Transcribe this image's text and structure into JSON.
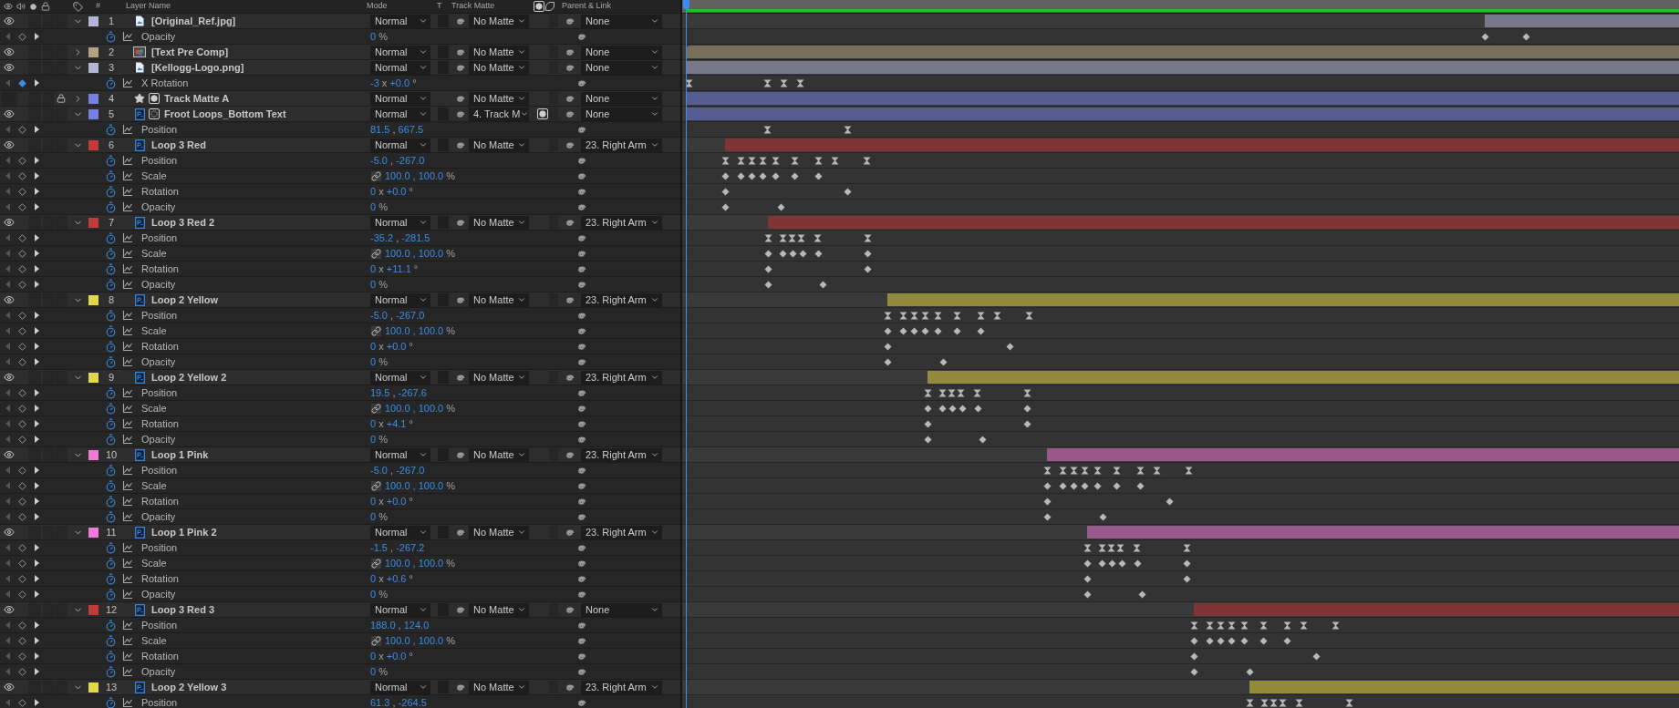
{
  "header": {
    "number": "#",
    "layer_name": "Layer Name",
    "mode": "Mode",
    "t": "T",
    "track_matte": "Track Matte",
    "parent": "Parent & Link"
  },
  "layers": [
    {
      "number": "1",
      "name": "[Original_Ref.jpg]",
      "color": "#b6b5d6",
      "visible": true,
      "locked": false,
      "expanded": true,
      "kind": "footage",
      "mode": "Normal",
      "track_matte": "No Matte",
      "parent": "None",
      "properties": [
        {
          "name": "Opacity",
          "value": [
            "0",
            "%"
          ],
          "at_keyframe": false
        }
      ]
    },
    {
      "number": "2",
      "name": "[Text Pre Comp]",
      "color": "#b4a582",
      "visible": true,
      "locked": false,
      "expanded": false,
      "kind": "comp",
      "mode": "Normal",
      "track_matte": "No Matte",
      "parent": "None"
    },
    {
      "number": "3",
      "name": "[Kellogg-Logo.png]",
      "color": "#b6b5d6",
      "visible": true,
      "locked": false,
      "expanded": true,
      "kind": "footage",
      "mode": "Normal",
      "track_matte": "No Matte",
      "parent": "None",
      "properties": [
        {
          "name": "X Rotation",
          "value": [
            "-3",
            "x",
            "+0.0",
            "°"
          ],
          "at_keyframe": true
        }
      ]
    },
    {
      "number": "4",
      "name": "Track Matte A",
      "color": "#7680e0",
      "visible": false,
      "locked": true,
      "expanded": false,
      "kind": "matte",
      "mode": "Normal",
      "track_matte": "No Matte",
      "parent": "None"
    },
    {
      "number": "5",
      "name": "Froot Loops_Bottom Text",
      "color": "#7680e0",
      "visible": true,
      "locked": false,
      "expanded": true,
      "kind": "matted",
      "mode": "Normal",
      "track_matte": "4. Track M",
      "parent": "None",
      "properties": [
        {
          "name": "Position",
          "value": [
            "81.5",
            ",",
            "667.5"
          ],
          "at_keyframe": false
        }
      ]
    },
    {
      "number": "6",
      "name": "Loop 3 Red",
      "color": "#c23a3a",
      "visible": true,
      "locked": false,
      "expanded": true,
      "kind": "psd",
      "mode": "Normal",
      "track_matte": "No Matte",
      "parent": "23. Right Arm",
      "properties": [
        {
          "name": "Position",
          "value": [
            "-5.0",
            ",",
            "-267.0"
          ],
          "at_keyframe": false
        },
        {
          "name": "Scale",
          "value": [
            "100.0 , 100.0",
            "%"
          ],
          "linked": true,
          "at_keyframe": false
        },
        {
          "name": "Rotation",
          "value": [
            "0",
            "x",
            "+0.0",
            "°"
          ],
          "at_keyframe": false
        },
        {
          "name": "Opacity",
          "value": [
            "0",
            "%"
          ],
          "at_keyframe": false
        }
      ]
    },
    {
      "number": "7",
      "name": "Loop 3 Red 2",
      "color": "#c23a3a",
      "visible": true,
      "locked": false,
      "expanded": true,
      "kind": "psd",
      "mode": "Normal",
      "track_matte": "No Matte",
      "parent": "23. Right Arm",
      "properties": [
        {
          "name": "Position",
          "value": [
            "-35.2",
            ",",
            "-281.5"
          ],
          "at_keyframe": false
        },
        {
          "name": "Scale",
          "value": [
            "100.0 , 100.0",
            "%"
          ],
          "linked": true,
          "at_keyframe": false
        },
        {
          "name": "Rotation",
          "value": [
            "0",
            "x",
            "+11.1",
            "°"
          ],
          "at_keyframe": false
        },
        {
          "name": "Opacity",
          "value": [
            "0",
            "%"
          ],
          "at_keyframe": false
        }
      ]
    },
    {
      "number": "8",
      "name": "Loop 2 Yellow",
      "color": "#e3d74a",
      "visible": true,
      "locked": false,
      "expanded": true,
      "kind": "psd",
      "mode": "Normal",
      "track_matte": "No Matte",
      "parent": "23. Right Arm",
      "properties": [
        {
          "name": "Position",
          "value": [
            "-5.0",
            ",",
            "-267.0"
          ],
          "at_keyframe": false
        },
        {
          "name": "Scale",
          "value": [
            "100.0 , 100.0",
            "%"
          ],
          "linked": true,
          "at_keyframe": false
        },
        {
          "name": "Rotation",
          "value": [
            "0",
            "x",
            "+0.0",
            "°"
          ],
          "at_keyframe": false
        },
        {
          "name": "Opacity",
          "value": [
            "0",
            "%"
          ],
          "at_keyframe": false
        }
      ]
    },
    {
      "number": "9",
      "name": "Loop 2 Yellow 2",
      "color": "#e3d74a",
      "visible": true,
      "locked": false,
      "expanded": true,
      "kind": "psd",
      "mode": "Normal",
      "track_matte": "No Matte",
      "parent": "23. Right Arm",
      "properties": [
        {
          "name": "Position",
          "value": [
            "19.5",
            ",",
            "-267.6"
          ],
          "at_keyframe": false
        },
        {
          "name": "Scale",
          "value": [
            "100.0 , 100.0",
            "%"
          ],
          "linked": true,
          "at_keyframe": false
        },
        {
          "name": "Rotation",
          "value": [
            "0",
            "x",
            "+4.1",
            "°"
          ],
          "at_keyframe": false
        },
        {
          "name": "Opacity",
          "value": [
            "0",
            "%"
          ],
          "at_keyframe": false
        }
      ]
    },
    {
      "number": "10",
      "name": "Loop 1 Pink",
      "color": "#f07ad6",
      "visible": true,
      "locked": false,
      "expanded": true,
      "kind": "psd",
      "mode": "Normal",
      "track_matte": "No Matte",
      "parent": "23. Right Arm",
      "properties": [
        {
          "name": "Position",
          "value": [
            "-5.0",
            ",",
            "-267.0"
          ],
          "at_keyframe": false
        },
        {
          "name": "Scale",
          "value": [
            "100.0 , 100.0",
            "%"
          ],
          "linked": true,
          "at_keyframe": false
        },
        {
          "name": "Rotation",
          "value": [
            "0",
            "x",
            "+0.0",
            "°"
          ],
          "at_keyframe": false
        },
        {
          "name": "Opacity",
          "value": [
            "0",
            "%"
          ],
          "at_keyframe": false
        }
      ]
    },
    {
      "number": "11",
      "name": "Loop 1 Pink 2",
      "color": "#f07ad6",
      "visible": true,
      "locked": false,
      "expanded": true,
      "kind": "psd",
      "mode": "Normal",
      "track_matte": "No Matte",
      "parent": "23. Right Arm",
      "properties": [
        {
          "name": "Position",
          "value": [
            "-1.5",
            ",",
            "-267.2"
          ],
          "at_keyframe": false
        },
        {
          "name": "Scale",
          "value": [
            "100.0 , 100.0",
            "%"
          ],
          "linked": true,
          "at_keyframe": false
        },
        {
          "name": "Rotation",
          "value": [
            "0",
            "x",
            "+0.6",
            "°"
          ],
          "at_keyframe": false
        },
        {
          "name": "Opacity",
          "value": [
            "0",
            "%"
          ],
          "at_keyframe": false
        }
      ]
    },
    {
      "number": "12",
      "name": "Loop 3 Red 3",
      "color": "#c23a3a",
      "visible": true,
      "locked": false,
      "expanded": true,
      "kind": "psd",
      "mode": "Normal",
      "track_matte": "No Matte",
      "parent": "None",
      "properties": [
        {
          "name": "Position",
          "value": [
            "188.0",
            ",",
            "124.0"
          ],
          "at_keyframe": false
        },
        {
          "name": "Scale",
          "value": [
            "100.0 , 100.0",
            "%"
          ],
          "linked": true,
          "at_keyframe": false
        },
        {
          "name": "Rotation",
          "value": [
            "0",
            "x",
            "+0.0",
            "°"
          ],
          "at_keyframe": false
        },
        {
          "name": "Opacity",
          "value": [
            "0",
            "%"
          ],
          "at_keyframe": false
        }
      ]
    },
    {
      "number": "13",
      "name": "Loop 2 Yellow 3",
      "color": "#e3d74a",
      "visible": true,
      "locked": false,
      "expanded": true,
      "kind": "psd",
      "mode": "Normal",
      "track_matte": "No Matte",
      "parent": "23. Right Arm",
      "properties": [
        {
          "name": "Position",
          "value": [
            "61.3",
            ",",
            "-264.5"
          ],
          "at_keyframe": false
        }
      ]
    }
  ]
}
